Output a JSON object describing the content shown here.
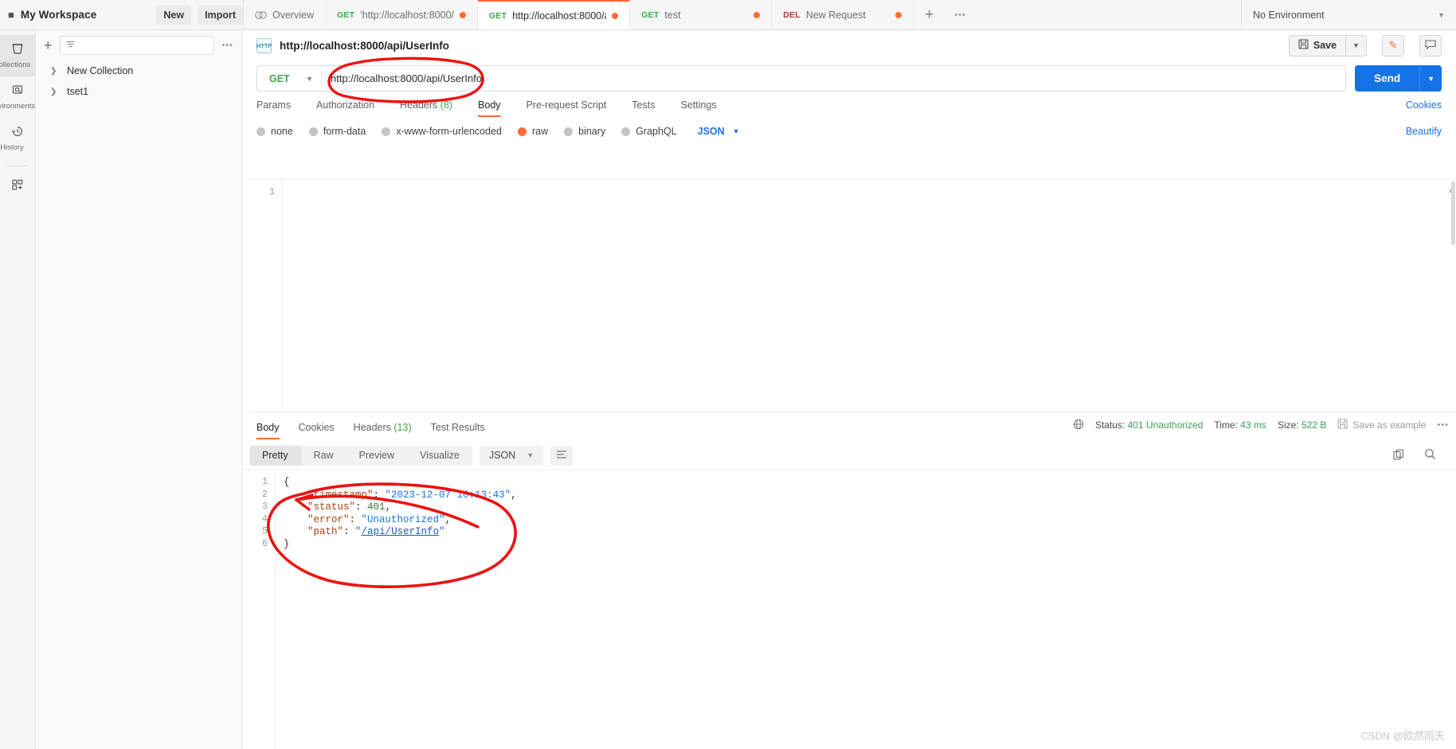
{
  "topbar": {
    "workspace_title": "My Workspace",
    "new_label": "New",
    "import_label": "Import",
    "add_tab_icon": "plus-icon",
    "more_tabs_icon": "ellipsis-icon",
    "environment_selected": "No Environment",
    "tabs": [
      {
        "verb": "",
        "label": "Overview",
        "icon": "overview-icon",
        "dirty": false,
        "active": false
      },
      {
        "verb": "GET",
        "label": "'http://localhost:8000/",
        "dirty": true,
        "active": false
      },
      {
        "verb": "GET",
        "label": "http://localhost:8000/a",
        "dirty": true,
        "active": true
      },
      {
        "verb": "GET",
        "label": "test",
        "dirty": true,
        "active": false
      },
      {
        "verb": "DEL",
        "label": "New Request",
        "dirty": true,
        "active": false
      }
    ]
  },
  "rail": {
    "items": [
      {
        "label": "Collections",
        "icon": "collections-icon",
        "active": true
      },
      {
        "label": "Environments",
        "icon": "environments-icon",
        "active": false
      },
      {
        "label": "History",
        "icon": "history-icon",
        "active": false
      }
    ],
    "footer_icon": "new-module-icon"
  },
  "sidebar": {
    "add_icon": "plus-icon",
    "filter_icon": "filter-icon",
    "filter_placeholder": "",
    "more_icon": "ellipsis-icon",
    "collections": [
      {
        "name": "New Collection",
        "expanded": false
      },
      {
        "name": "tset1",
        "expanded": false
      }
    ]
  },
  "request": {
    "protocol_badge": "HTTP",
    "title": "http://localhost:8000/api/UserInfo",
    "save_label": "Save",
    "save_icon": "floppy-icon",
    "save_caret_icon": "chevron-down-icon",
    "edit_icon": "pencil-icon",
    "comment_icon": "comment-icon",
    "method": "GET",
    "url": "http://localhost:8000/api/UserInfo",
    "send_label": "Send",
    "cookies_label": "Cookies",
    "beautify_label": "Beautify",
    "tabs": [
      {
        "label": "Params",
        "count": "",
        "active": false
      },
      {
        "label": "Authorization",
        "count": "",
        "active": false
      },
      {
        "label": "Headers",
        "count": "(8)",
        "active": false
      },
      {
        "label": "Body",
        "count": "",
        "active": true
      },
      {
        "label": "Pre-request Script",
        "count": "",
        "active": false
      },
      {
        "label": "Tests",
        "count": "",
        "active": false
      },
      {
        "label": "Settings",
        "count": "",
        "active": false
      }
    ],
    "body_types": [
      {
        "label": "none",
        "selected": false
      },
      {
        "label": "form-data",
        "selected": false
      },
      {
        "label": "x-www-form-urlencoded",
        "selected": false
      },
      {
        "label": "raw",
        "selected": true
      },
      {
        "label": "binary",
        "selected": false
      },
      {
        "label": "GraphQL",
        "selected": false
      }
    ],
    "body_format": "JSON",
    "body_format_caret": "chevron-down-icon",
    "editor_line_numbers": [
      "1"
    ],
    "editor_content": ""
  },
  "response": {
    "tabs": [
      {
        "label": "Body",
        "count": "",
        "active": true
      },
      {
        "label": "Cookies",
        "count": "",
        "active": false
      },
      {
        "label": "Headers",
        "count": "(13)",
        "active": false
      },
      {
        "label": "Test Results",
        "count": "",
        "active": false
      }
    ],
    "globe_icon": "globe-icon",
    "status_label": "Status:",
    "status_value": "401 Unauthorized",
    "time_label": "Time:",
    "time_value": "43 ms",
    "size_label": "Size:",
    "size_value": "522 B",
    "save_example_label": "Save as example",
    "save_example_icon": "floppy-icon",
    "more_icon": "ellipsis-icon",
    "view_modes": [
      {
        "label": "Pretty",
        "active": true
      },
      {
        "label": "Raw",
        "active": false
      },
      {
        "label": "Preview",
        "active": false
      },
      {
        "label": "Visualize",
        "active": false
      }
    ],
    "format": "JSON",
    "format_caret": "chevron-down-icon",
    "wrap_icon": "word-wrap-icon",
    "copy_icon": "copy-icon",
    "search_icon": "search-icon",
    "body_lines": [
      {
        "n": "1",
        "fold": "{",
        "tokens": []
      },
      {
        "n": "2",
        "fold": "",
        "tokens": [
          {
            "t": "    ",
            "c": "jp"
          },
          {
            "t": "\"timestamp\"",
            "c": "jk"
          },
          {
            "t": ": ",
            "c": "jp"
          },
          {
            "t": "\"2023-12-07 10:13:43\"",
            "c": "js"
          },
          {
            "t": ",",
            "c": "jp"
          }
        ]
      },
      {
        "n": "3",
        "fold": "",
        "tokens": [
          {
            "t": "    ",
            "c": "jp"
          },
          {
            "t": "\"status\"",
            "c": "jk"
          },
          {
            "t": ": ",
            "c": "jp"
          },
          {
            "t": "401",
            "c": "jn"
          },
          {
            "t": ",",
            "c": "jp"
          }
        ]
      },
      {
        "n": "4",
        "fold": "",
        "tokens": [
          {
            "t": "    ",
            "c": "jp"
          },
          {
            "t": "\"error\"",
            "c": "jk"
          },
          {
            "t": ": ",
            "c": "jp"
          },
          {
            "t": "\"Unauthorized\"",
            "c": "js"
          },
          {
            "t": ",",
            "c": "jp"
          }
        ]
      },
      {
        "n": "5",
        "fold": "",
        "tokens": [
          {
            "t": "    ",
            "c": "jp"
          },
          {
            "t": "\"path\"",
            "c": "jk"
          },
          {
            "t": ": ",
            "c": "jp"
          },
          {
            "t": "\"",
            "c": "js"
          },
          {
            "t": "/api/UserInfo",
            "c": "jlink"
          },
          {
            "t": "\"",
            "c": "js"
          }
        ]
      },
      {
        "n": "6",
        "fold": "}",
        "tokens": []
      }
    ]
  },
  "watermark": "CSDN @欧然雨天"
}
